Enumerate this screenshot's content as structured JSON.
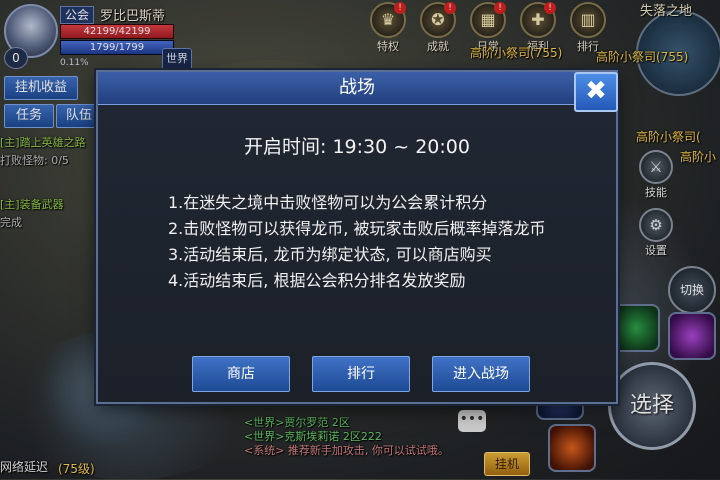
{
  "player": {
    "guild_label": "公会",
    "name": "罗比巴斯蒂",
    "hp": "42199/42199",
    "mp": "1799/1799",
    "hp_fraction": 1.0,
    "mp_fraction": 1.0,
    "level": "0",
    "exp": "0.11%",
    "world_label": "世界"
  },
  "left_panel": {
    "idle_reward": "挂机收益",
    "tab_task": "任务",
    "tab_team": "队伍",
    "quests": [
      "[主]踏上英雄之路",
      "打败怪物: 0/5",
      "[主]装备武器",
      "完成"
    ]
  },
  "top_features": [
    {
      "label": "特权",
      "icon": "crown-icon",
      "badge": "!"
    },
    {
      "label": "成就",
      "icon": "medal-icon",
      "badge": "!"
    },
    {
      "label": "日常",
      "icon": "calendar-icon",
      "badge": "!"
    },
    {
      "label": "福利",
      "icon": "gift-icon",
      "badge": "!"
    },
    {
      "label": "排行",
      "icon": "ranking-icon",
      "badge": ""
    }
  ],
  "minimap": {
    "name": "失落之地"
  },
  "npcs": [
    "高阶小祭司(755)",
    "高阶小祭司(755)",
    "高阶小祭司(",
    "高阶小"
  ],
  "side_icons": [
    {
      "label": "技能",
      "icon": "skill-icon"
    },
    {
      "label": "设置",
      "icon": "settings-icon"
    }
  ],
  "switch_label": "切换",
  "select_label": "选择",
  "chat": [
    {
      "text": "<世界>贾尔罗范 2区",
      "type": "world"
    },
    {
      "text": "<世界>克斯埃莉诺 2区222",
      "type": "world"
    },
    {
      "text": "<系统> 推荐新手加攻击, 你可以试试哦。",
      "type": "system"
    }
  ],
  "auto_label": "挂机",
  "latency_label": "网络延迟",
  "bottom_guild": "(75级)",
  "dialog": {
    "title": "战场",
    "open_time": "开启时间: 19:30 ~ 20:00",
    "rules": [
      "1.在迷失之境中击败怪物可以为公会累计积分",
      "2.击败怪物可以获得龙币, 被玩家击败后概率掉落龙币",
      "3.活动结束后, 龙币为绑定状态, 可以商店购买",
      "4.活动结束后, 根据公会积分排名发放奖励"
    ],
    "btn_shop": "商店",
    "btn_rank": "排行",
    "btn_enter": "进入战场",
    "close_symbol": "✖"
  }
}
